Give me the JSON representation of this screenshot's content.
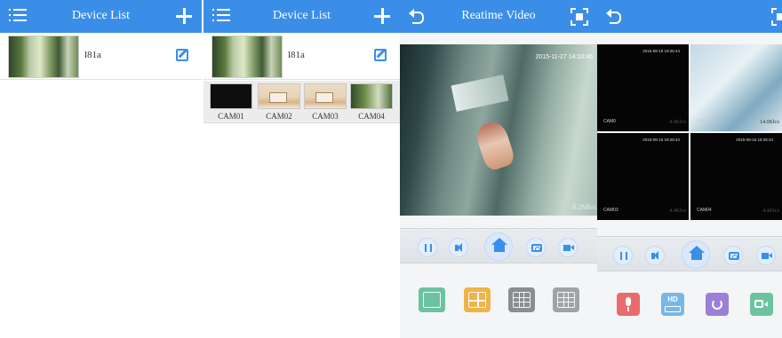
{
  "panel1": {
    "header": {
      "title": "Device List",
      "menu_icon": "menu-icon",
      "add_icon": "plus-icon"
    },
    "device": {
      "name": "l81a",
      "edit_icon": "edit-icon"
    }
  },
  "panel2": {
    "header": {
      "title": "Device List",
      "menu_icon": "menu-icon",
      "add_icon": "plus-icon"
    },
    "device": {
      "name": "l81a",
      "edit_icon": "edit-icon"
    },
    "cameras": [
      {
        "label": "CAM01"
      },
      {
        "label": "CAM02"
      },
      {
        "label": "CAM03"
      },
      {
        "label": "CAM04"
      }
    ]
  },
  "panel3": {
    "header": {
      "title": "Reatime Video",
      "back_icon": "back-icon",
      "fullscreen_icon": "fullscreen-icon"
    },
    "video": {
      "timestamp": "2015-11-27 14:10:46",
      "bitrate": "6.2Mb/s"
    },
    "controls": [
      "pause-icon",
      "volume-icon",
      "home-icon",
      "snapshot-icon",
      "record-icon"
    ],
    "layouts": [
      "single-view-icon",
      "four-view-icon",
      "nine-view-icon",
      "sixteen-view-icon"
    ]
  },
  "panel4": {
    "header": {
      "back_icon": "back-icon",
      "fullscreen_icon": "fullscreen-icon"
    },
    "grid": [
      {
        "timestamp": "2015-08-16 19:26:44",
        "label": "CAM0",
        "rate": "4.4Kb/s"
      },
      {
        "timestamp": "",
        "label": "CAM02",
        "rate": "14.0Kb/s"
      },
      {
        "timestamp": "2015-08-16 19:26:44",
        "label": "CAM03",
        "rate": "4.4Kb/s"
      },
      {
        "timestamp": "2015-08-16 19:26:44",
        "label": "CAM04",
        "rate": "4.4Kb/s"
      }
    ],
    "controls": [
      "pause-icon",
      "volume-icon",
      "home-icon",
      "snapshot-icon",
      "record-icon"
    ],
    "functions": {
      "hd_label": "HD"
    }
  },
  "colors": {
    "accent": "#3b8ee8",
    "mic": "#e86c6c",
    "hd": "#78b7e6",
    "rotate": "#9b7fd9",
    "record": "#6cc3a0",
    "single": "#6cc3a0",
    "four": "#f0b34a"
  }
}
